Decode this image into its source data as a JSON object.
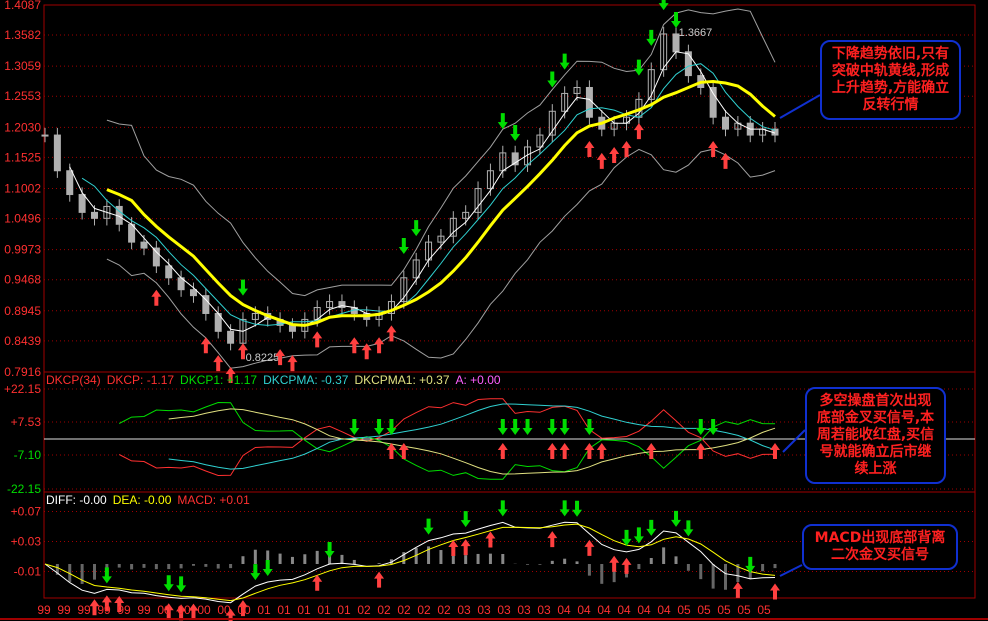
{
  "chart_data": {
    "type": "line",
    "title": "weekly price with Bollinger bands, DKCP and MACD indicators",
    "colors": {
      "up": "#ff3030",
      "down": "#00dd00",
      "ma": "#ffff00",
      "band": "#a0a0a0",
      "grid": "#a00000",
      "axis": "#ff3030",
      "cyan": "#30d0d0",
      "khaki": "#e0e080",
      "magenta": "#ff60ff"
    },
    "price_panel": {
      "ylim": [
        0.7916,
        1.4087
      ],
      "yticks": [
        "1.4087",
        "1.3582",
        "1.3059",
        "1.2553",
        "1.2030",
        "1.1525",
        "1.1002",
        "1.0496",
        "0.9973",
        "0.9468",
        "0.8945",
        "0.8439",
        "0.7916"
      ],
      "close": [
        1.19,
        1.13,
        1.09,
        1.06,
        1.05,
        1.07,
        1.04,
        1.01,
        1.0,
        0.97,
        0.95,
        0.93,
        0.92,
        0.89,
        0.86,
        0.84,
        0.88,
        0.89,
        0.88,
        0.87,
        0.86,
        0.88,
        0.9,
        0.91,
        0.9,
        0.89,
        0.88,
        0.89,
        0.91,
        0.95,
        0.98,
        1.01,
        1.02,
        1.05,
        1.06,
        1.1,
        1.13,
        1.16,
        1.14,
        1.17,
        1.19,
        1.23,
        1.26,
        1.27,
        1.22,
        1.2,
        1.21,
        1.22,
        1.25,
        1.3,
        1.36,
        1.33,
        1.29,
        1.27,
        1.22,
        1.2,
        1.21,
        1.19,
        1.2,
        1.19
      ],
      "high_label": "1.3667",
      "low_label": "0.8225",
      "buy_signals": [
        9,
        13,
        14,
        15,
        16,
        19,
        20,
        22,
        25,
        26,
        27,
        28,
        44,
        45,
        46,
        47,
        48,
        54,
        55
      ],
      "sell_signals": [
        16,
        29,
        30,
        37,
        38,
        41,
        42,
        48,
        49,
        50,
        51
      ]
    },
    "dkcp_panel": {
      "legend": [
        {
          "text": "DKCP(34)",
          "color": "#ff3030"
        },
        {
          "text": "DKCP: -1.17",
          "color": "#ff3030"
        },
        {
          "text": "DKCP1: +1.17",
          "color": "#00dd00"
        },
        {
          "text": "DKCPMA: -0.37",
          "color": "#30d0d0"
        },
        {
          "text": "DKCPMA1: +0.37",
          "color": "#e0e080"
        },
        {
          "text": "A: +0.00",
          "color": "#ff60ff"
        }
      ],
      "yticks": [
        {
          "label": "+22.15",
          "v": 22.15,
          "color": "#ff3030"
        },
        {
          "label": "+7.53",
          "v": 7.53,
          "color": "#ff3030"
        },
        {
          "label": "-7.10",
          "v": -7.1,
          "color": "#00dd00"
        },
        {
          "label": "-22.15",
          "v": -22.15,
          "color": "#00dd00"
        }
      ],
      "buy_signals": [
        28,
        29,
        37,
        41,
        42,
        44,
        45,
        49,
        53,
        59
      ],
      "sell_signals": [
        25,
        27,
        28,
        37,
        38,
        39,
        41,
        42,
        44,
        53,
        54
      ]
    },
    "macd_panel": {
      "legend": [
        {
          "text": "DIFF: -0.00",
          "color": "#ffffff"
        },
        {
          "text": "DEA: -0.00",
          "color": "#ffff00"
        },
        {
          "text": "MACD: +0.01",
          "color": "#ff3030"
        }
      ],
      "yticks": [
        {
          "label": "+0.07",
          "v": 0.07
        },
        {
          "label": "+0.03",
          "v": 0.03
        },
        {
          "label": "-0.01",
          "v": -0.01
        }
      ],
      "buy_signals": [
        4,
        5,
        6,
        10,
        11,
        12,
        15,
        16,
        22,
        27,
        33,
        34,
        36,
        41,
        44,
        46,
        47,
        56,
        59
      ],
      "sell_signals": [
        5,
        10,
        11,
        17,
        18,
        23,
        31,
        34,
        37,
        42,
        43,
        47,
        48,
        49,
        51,
        52,
        57
      ]
    },
    "x_labels": [
      "99",
      "99",
      "99",
      "99",
      "99",
      "99",
      "00",
      "00",
      "00",
      "00",
      "00",
      "01",
      "01",
      "01",
      "01",
      "01",
      "02",
      "02",
      "02",
      "02",
      "02",
      "03",
      "03",
      "03",
      "03",
      "03",
      "04",
      "04",
      "04",
      "04",
      "04",
      "04",
      "05",
      "05",
      "05",
      "05",
      "05"
    ]
  },
  "annotations": {
    "price": "下降趋势依旧,只有突破中轨黄线,形成上升趋势,方能确立反转行情",
    "dkcp": "多空操盘首次出现底部金叉买信号,本周若能收红盘,买信号就能确立后市继续上涨",
    "macd": "MACD出现底部背离二次金叉买信号"
  }
}
